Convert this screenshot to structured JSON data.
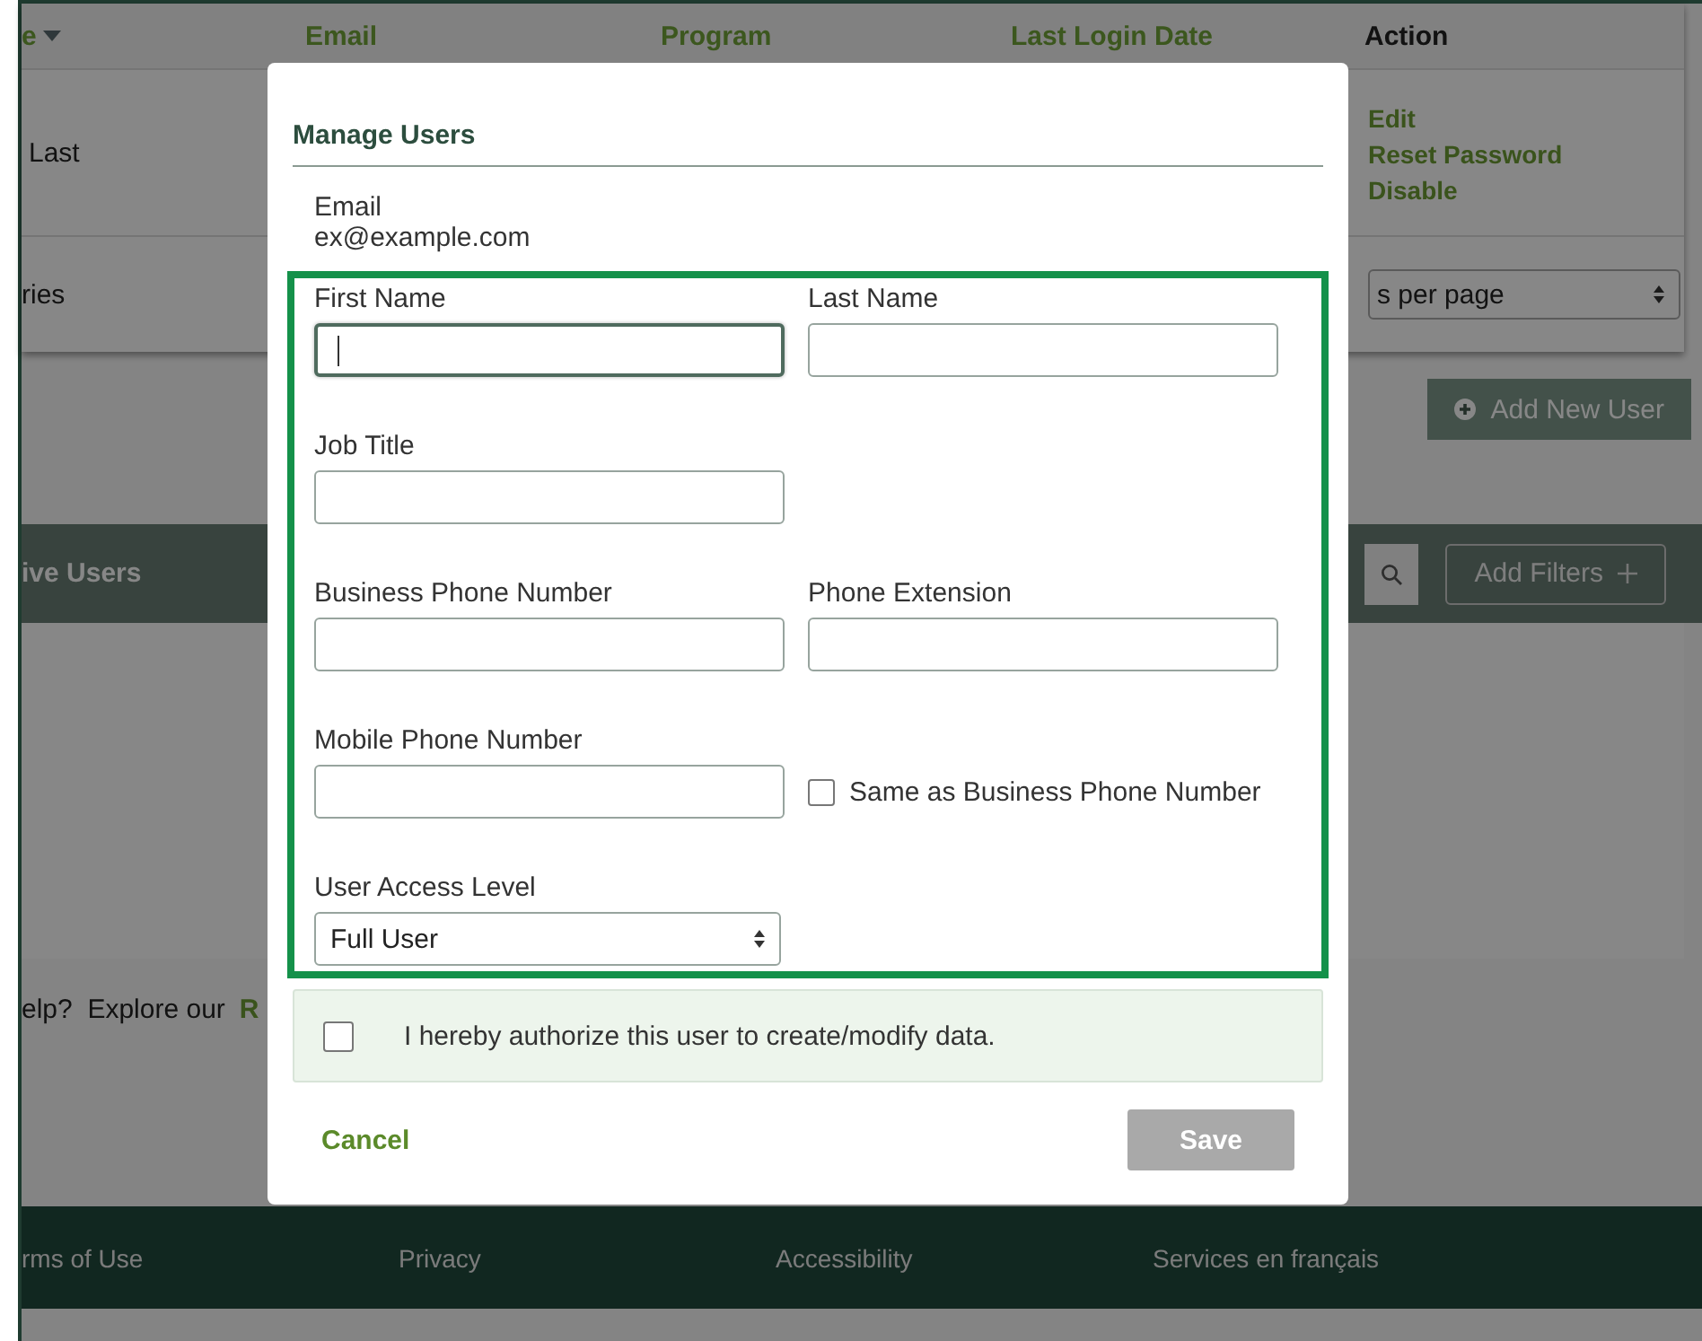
{
  "table": {
    "columns": [
      {
        "label": "e",
        "sortable": true
      },
      {
        "label": "Email",
        "sortable": false
      },
      {
        "label": "Program",
        "sortable": false
      },
      {
        "label": "Last Login Date",
        "sortable": false
      },
      {
        "label": "Action",
        "sortable": false
      }
    ],
    "rows": [
      {
        "name": "Last",
        "actions": [
          "Edit",
          "Reset Password",
          "Disable"
        ]
      }
    ],
    "footer": {
      "label": "ries",
      "page_size": "s per page"
    }
  },
  "add_user_button": "Add New User",
  "users_bar": {
    "title": "ive Users",
    "filters_button": "Add Filters"
  },
  "help": {
    "text": "elp?  Explore our",
    "link": "R"
  },
  "footer_links": [
    "rms of Use",
    "Privacy",
    "Accessibility",
    "Services en français"
  ],
  "modal": {
    "title": "Manage Users",
    "email_label": "Email",
    "email_value": "ex@example.com",
    "rows": [
      [
        {
          "kind": "text",
          "label": "First Name",
          "focused": true
        },
        {
          "kind": "text",
          "label": "Last Name",
          "focused": false
        }
      ],
      [
        {
          "kind": "text",
          "label": "Job Title",
          "focused": false
        }
      ],
      [
        {
          "kind": "text",
          "label": "Business Phone Number",
          "focused": false
        },
        {
          "kind": "text",
          "label": "Phone Extension",
          "focused": false
        }
      ],
      [
        {
          "kind": "text",
          "label": "Mobile Phone Number",
          "focused": false
        },
        {
          "kind": "checkbox",
          "label": "Same as Business Phone Number",
          "checked": false
        }
      ],
      [
        {
          "kind": "select",
          "label": "User Access Level",
          "value": "Full User"
        }
      ]
    ],
    "authorize": {
      "label": "I hereby authorize this user to create/modify data.",
      "checked": false
    },
    "cancel": "Cancel",
    "save": {
      "label": "Save",
      "disabled": true
    }
  }
}
